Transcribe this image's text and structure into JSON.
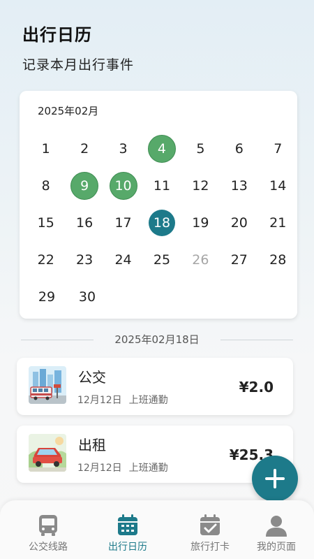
{
  "header": {
    "title": "出行日历",
    "subtitle": "记录本月出行事件"
  },
  "calendar": {
    "month_label": "2025年02月",
    "event_days": [
      4,
      9,
      10
    ],
    "selected_day": 18,
    "muted_day": 26,
    "weeks": [
      [
        "1",
        "2",
        "3",
        "4",
        "5",
        "6",
        "7"
      ],
      [
        "8",
        "9",
        "10",
        "11",
        "12",
        "13",
        "14"
      ],
      [
        "15",
        "16",
        "17",
        "18",
        "19",
        "20",
        "21"
      ],
      [
        "22",
        "23",
        "24",
        "25",
        "26",
        "27",
        "28"
      ],
      [
        "29",
        "30"
      ]
    ]
  },
  "selected_date_label": "2025年02月18日",
  "trips": [
    {
      "title": "公交",
      "date": "12月12日",
      "tag": "上班通勤",
      "price": "¥2.0",
      "icon": "bus-thumbnail"
    },
    {
      "title": "出租",
      "date": "12月12日",
      "tag": "上班通勤",
      "price": "¥25.3",
      "icon": "taxi-thumbnail"
    }
  ],
  "fab": {
    "icon": "plus-icon"
  },
  "tabs": [
    {
      "label": "公交线路",
      "icon": "bus-icon",
      "active": false
    },
    {
      "label": "出行日历",
      "icon": "calendar-icon",
      "active": true
    },
    {
      "label": "旅行打卡",
      "icon": "calendar-check-icon",
      "active": false
    },
    {
      "label": "我的页面",
      "icon": "user-icon",
      "active": false
    }
  ],
  "colors": {
    "accent": "#1d7a8a",
    "event": "#57a96a",
    "inactive_tab": "#777777",
    "muted_day": "#a6a6a6"
  }
}
